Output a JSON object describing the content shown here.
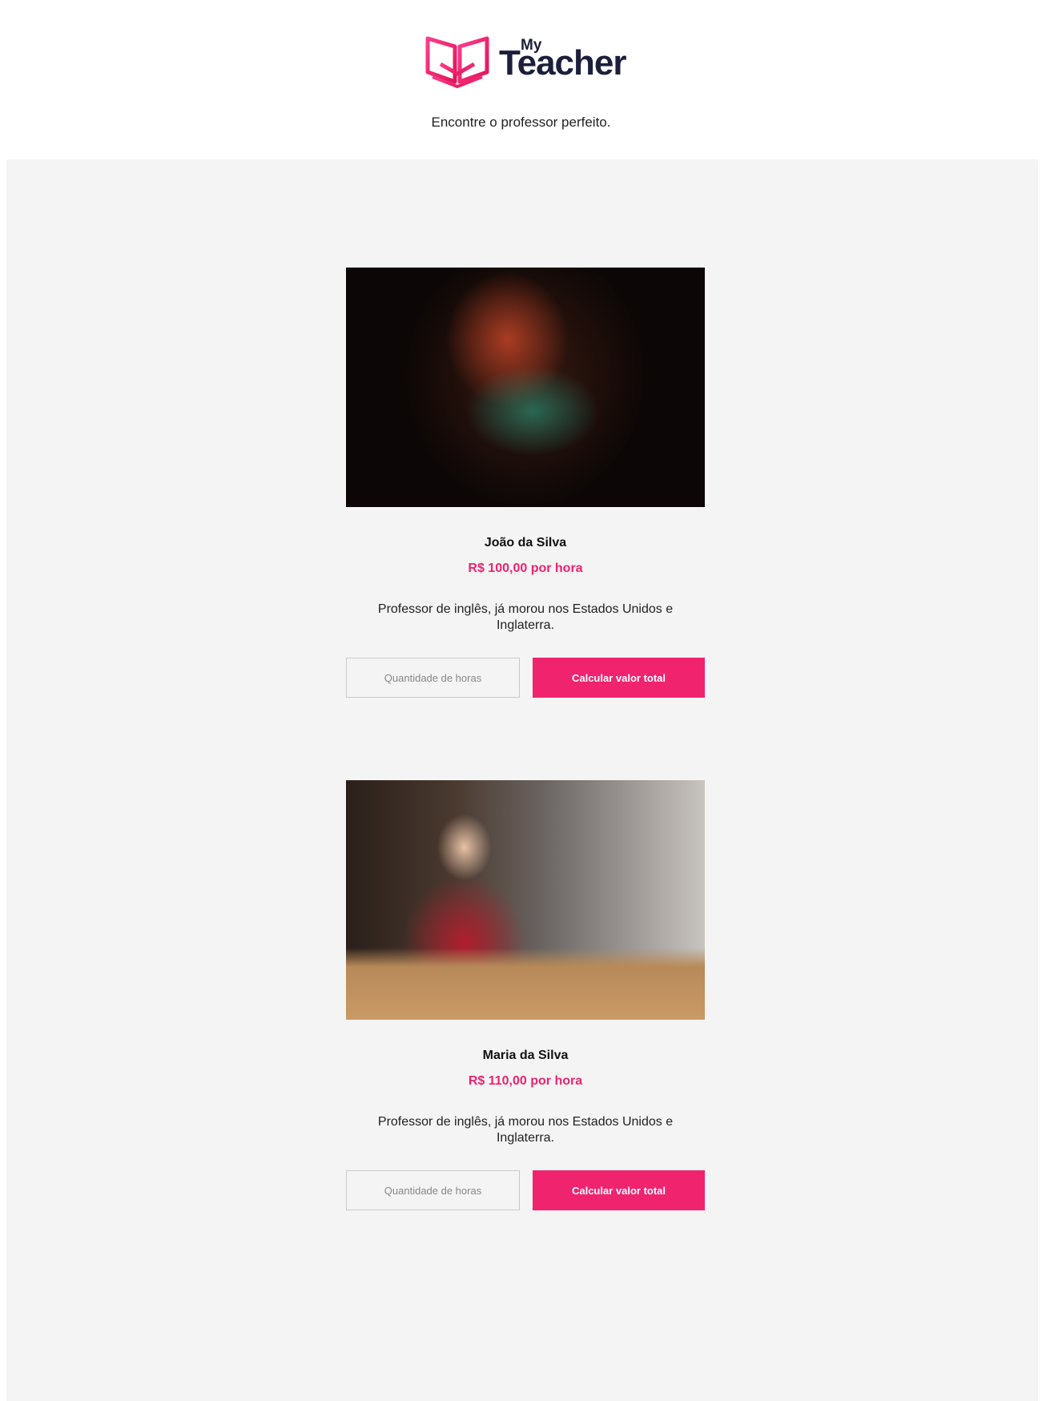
{
  "brand": {
    "logo_top": "My",
    "logo_main": "Teacher",
    "accent_color": "#f0236f",
    "text_color": "#1b1f3b"
  },
  "tagline": "Encontre o professor perfeito.",
  "teachers": [
    {
      "photo_icon": "teacher-portrait-photo",
      "name": "João da Silva",
      "price": "R$ 100,00 por hora",
      "description": "Professor de inglês, já morou nos Estados Unidos e Inglaterra.",
      "hours_placeholder": "Quantidade de horas",
      "button_label": "Calcular valor total"
    },
    {
      "photo_icon": "teacher-portrait-photo",
      "name": "Maria da Silva",
      "price": "R$ 110,00 por hora",
      "description": "Professor de inglês, já morou nos Estados Unidos e Inglaterra.",
      "hours_placeholder": "Quantidade de horas",
      "button_label": "Calcular valor total"
    }
  ]
}
